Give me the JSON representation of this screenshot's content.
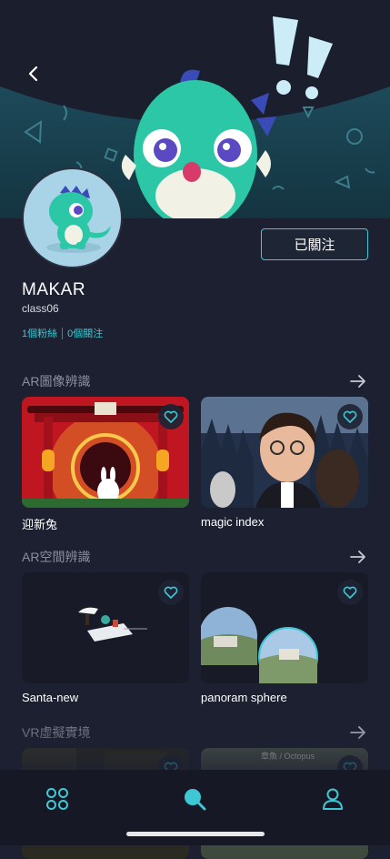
{
  "profile": {
    "name": "MAKAR",
    "id": "class06",
    "followers": "1個粉絲",
    "following": "0個關注",
    "follow_button": "已關注"
  },
  "sections": [
    {
      "title": "AR圖像辨識",
      "items": [
        {
          "label": "迎新兔",
          "favorited": false
        },
        {
          "label": "magic index",
          "favorited": false
        }
      ]
    },
    {
      "title": "AR空間辨識",
      "items": [
        {
          "label": "Santa-new",
          "favorited": false
        },
        {
          "label": "panoram sphere",
          "favorited": false
        }
      ]
    },
    {
      "title": "VR虛擬實境",
      "items": [
        {
          "label": "",
          "favorited": false
        },
        {
          "label": "章魚 / Octopus",
          "favorited": false
        }
      ]
    }
  ],
  "nav": {
    "items": [
      "grid-icon",
      "search-icon",
      "user-icon"
    ],
    "active": "search-icon"
  },
  "colors": {
    "accent": "#3ec8d3",
    "background": "#1c2030",
    "navbar": "#161925",
    "section_title": "#8b90a0"
  }
}
